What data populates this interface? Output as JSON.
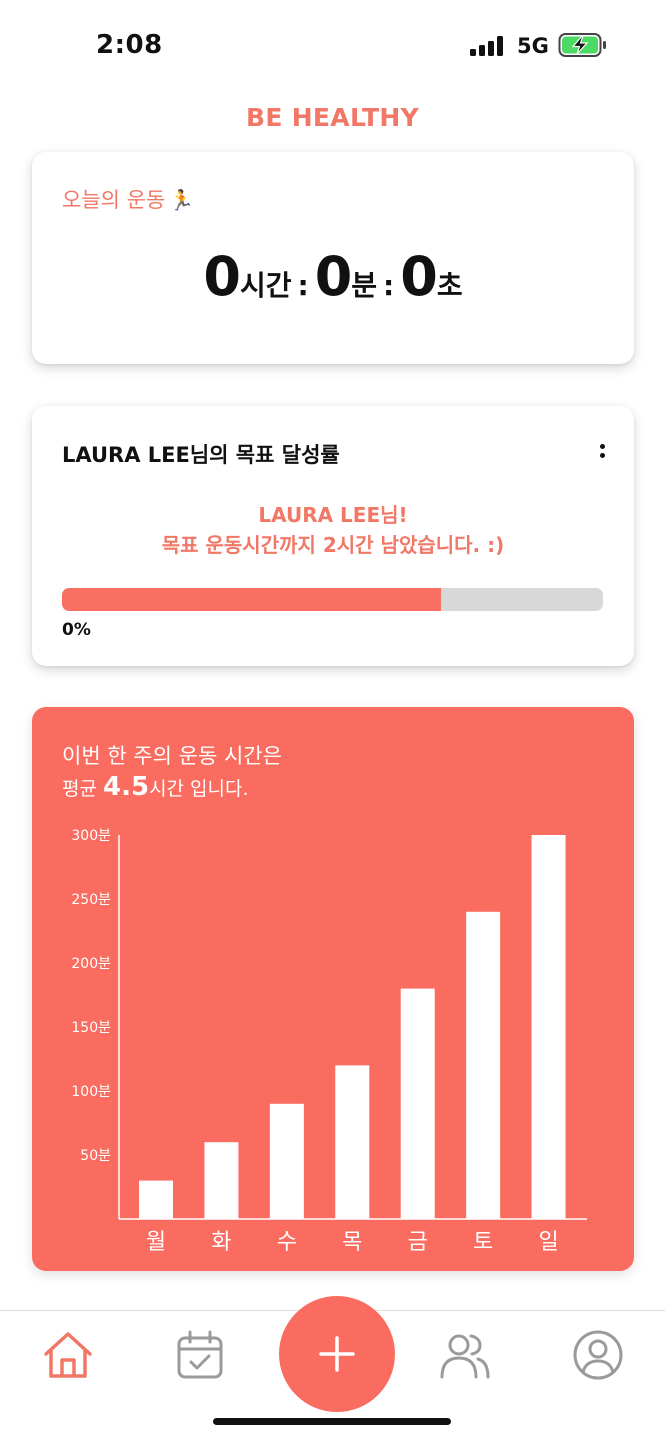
{
  "status_bar": {
    "time": "2:08",
    "network": "5G",
    "icons": [
      "signal-icon",
      "battery-charging-icon"
    ]
  },
  "app": {
    "title": "BE HEALTHY",
    "accent_color": "#f17766",
    "card_color": "#fa6c60"
  },
  "today": {
    "title": "오늘의 운동",
    "title_icon": "running-person-emoji",
    "hours": "0",
    "hours_unit": "시간",
    "minutes": "0",
    "minutes_unit": "분",
    "seconds": "0",
    "seconds_unit": "초",
    "separator": ":"
  },
  "goal": {
    "title": "LAURA LEE님의 목표 달성률",
    "menu_icon": "vertical-dots-icon",
    "message_line1": "LAURA LEE님!",
    "message_line2": "목표 운동시간까지 2시간 남았습니다. :)",
    "progress_fraction": 0.7,
    "progress_label": "0%"
  },
  "week": {
    "line1": "이번 한 주의 운동 시간은",
    "line2_prefix": "평균 ",
    "line2_avg": "4.5",
    "line2_suffix": "시간 입니다."
  },
  "chart_data": {
    "type": "bar",
    "categories": [
      "월",
      "화",
      "수",
      "목",
      "금",
      "토",
      "일"
    ],
    "values": [
      30,
      60,
      90,
      120,
      180,
      240,
      300
    ],
    "y_ticks": [
      50,
      100,
      150,
      200,
      250,
      300
    ],
    "y_tick_labels": [
      "50분",
      "100분",
      "150분",
      "200분",
      "250분",
      "300분"
    ],
    "ylim": [
      0,
      300
    ],
    "bar_color": "#ffffff",
    "grid": false
  },
  "nav": {
    "items": [
      {
        "icon": "home-icon",
        "active": true
      },
      {
        "icon": "calendar-check-icon",
        "active": false
      },
      {
        "icon": "plus-icon",
        "active": false
      },
      {
        "icon": "users-icon",
        "active": false
      },
      {
        "icon": "profile-icon",
        "active": false
      }
    ]
  }
}
